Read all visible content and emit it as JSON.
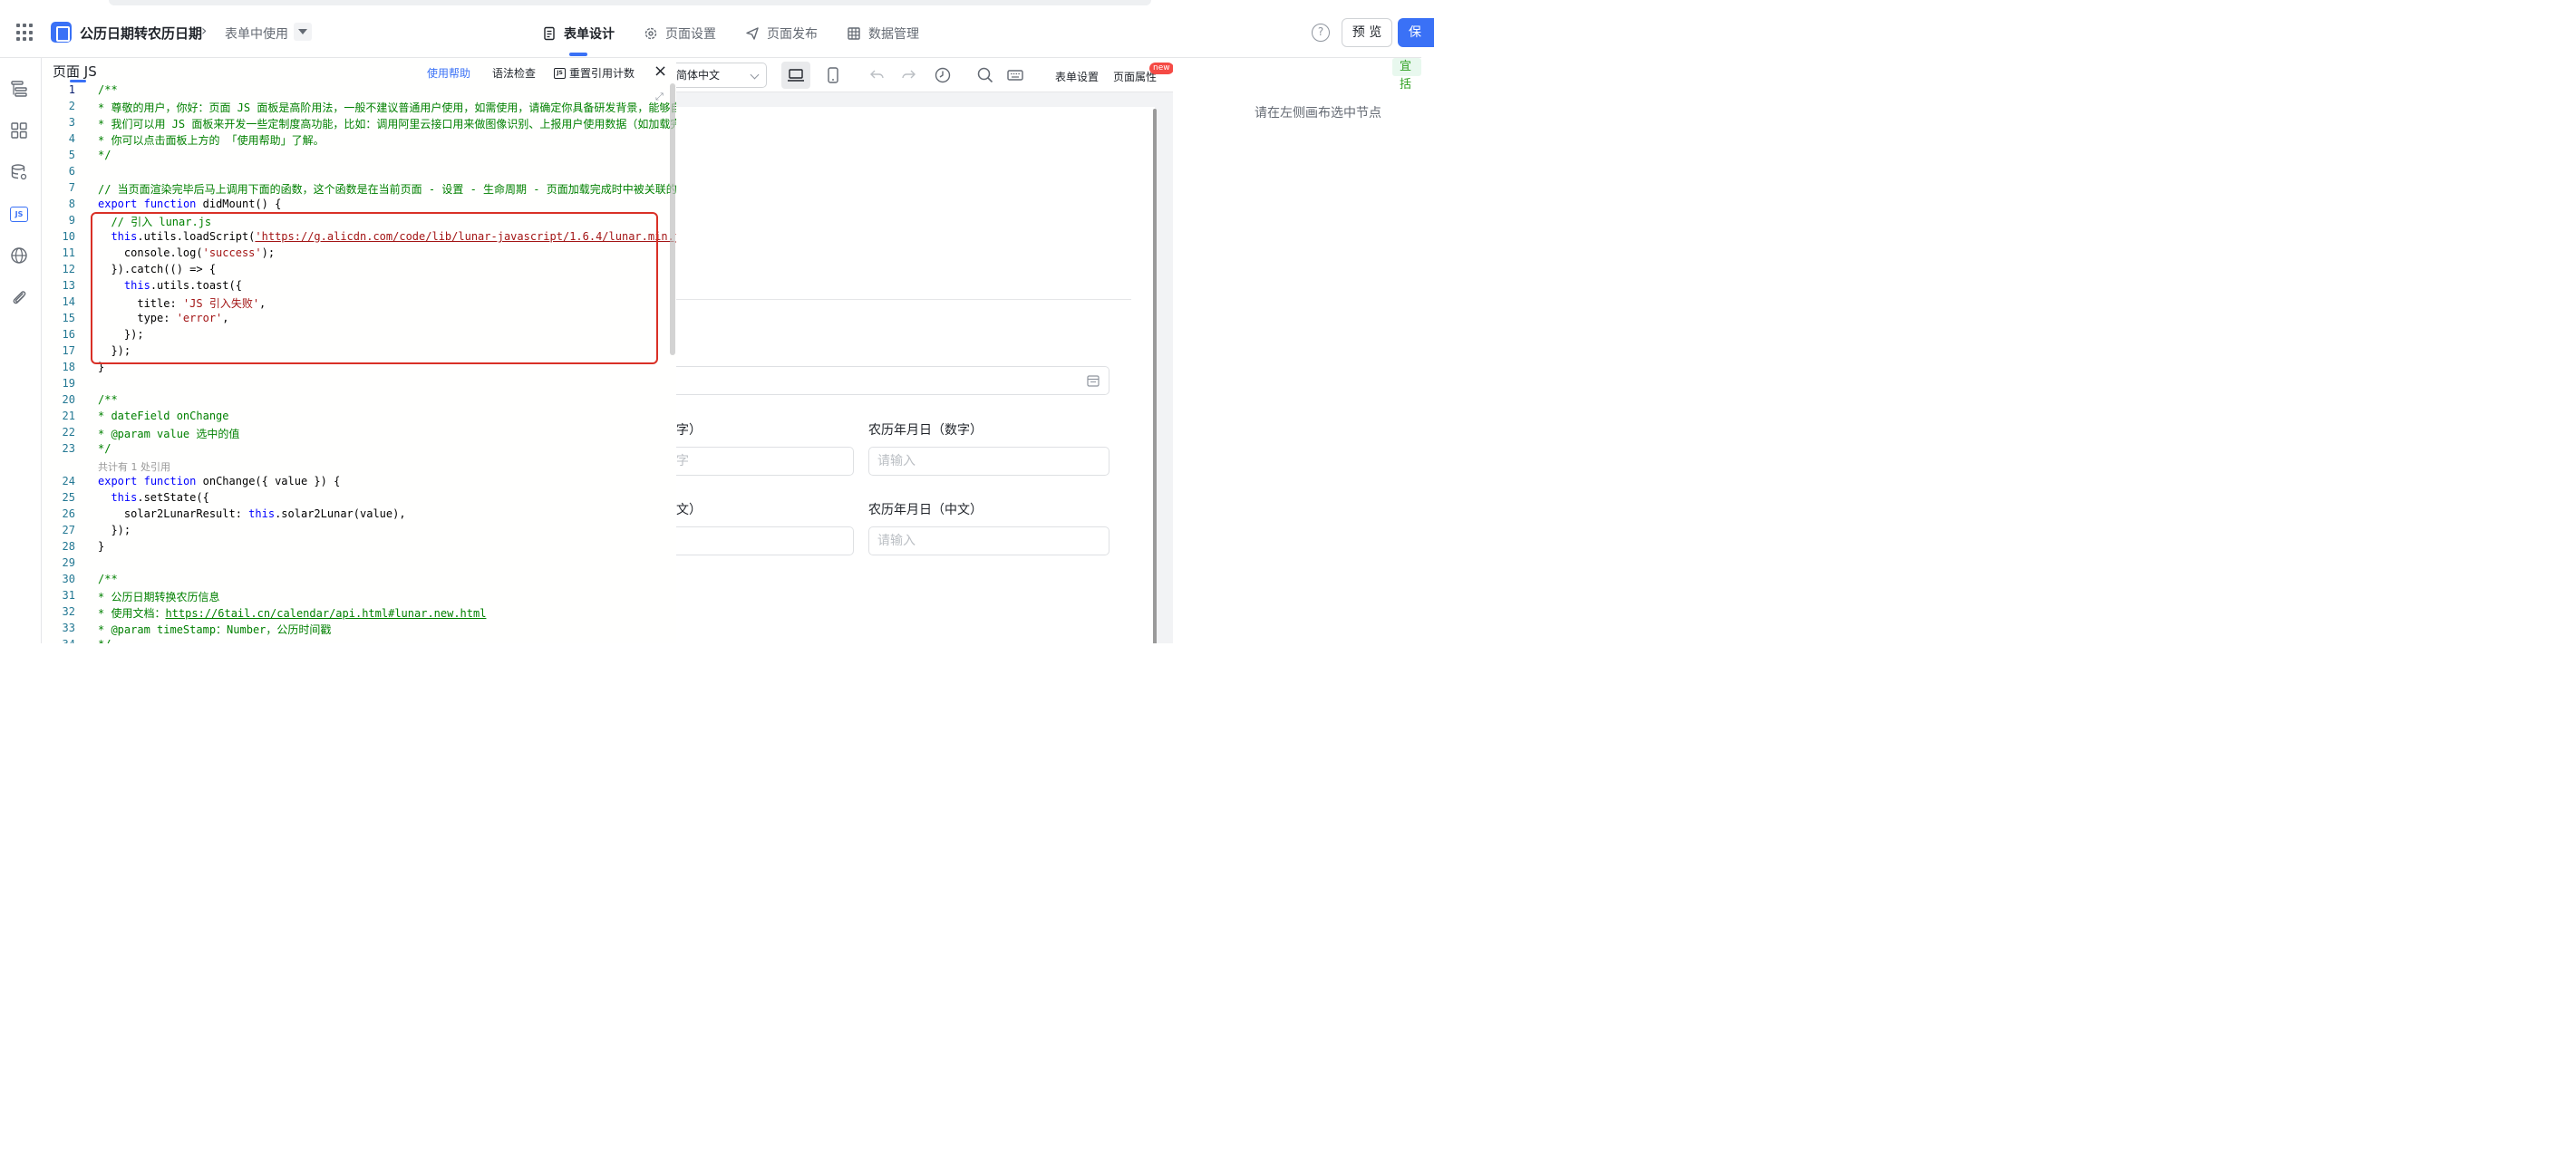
{
  "header": {
    "app_title": "公历日期转农历日期",
    "breadcrumb_sep": "›",
    "page_name": "表单中使用",
    "tabs": [
      {
        "label": "表单设计"
      },
      {
        "label": "页面设置"
      },
      {
        "label": "页面发布"
      },
      {
        "label": "数据管理"
      }
    ],
    "help": "?",
    "preview_label": "预 览",
    "save_label": "保"
  },
  "code_panel": {
    "title": "页面 JS",
    "help_link": "使用帮助",
    "lint_link": "语法检查",
    "reset_ref_link": "重置引用计数",
    "close": "×",
    "expand": "⤢",
    "line_numbers": [
      "1",
      "2",
      "3",
      "4",
      "5",
      "6",
      "7",
      "8",
      "9",
      "10",
      "11",
      "12",
      "13",
      "14",
      "15",
      "16",
      "17",
      "18",
      "19",
      "20",
      "21",
      "22",
      "23",
      "24",
      "25",
      "26",
      "27",
      "28",
      "29",
      "30",
      "31",
      "32",
      "33",
      "34"
    ],
    "ref_hint": "共计有 1 处引用",
    "lines": {
      "l1": "/**",
      "l2": "* 尊敬的用户，你好：页面 JS 面板是高阶用法，一般不建议普通用户使用，如需使用，请确定你具备研发背景，能够自",
      "l3": "* 我们可以用 JS 面板来开发一些定制度高功能，比如：调用阿里云接口用来做图像识别、上报用户使用数据（如加载完",
      "l4": "* 你可以点击面板上方的 「使用帮助」了解。",
      "l5": "*/",
      "l7": "// 当页面渲染完毕后马上调用下面的函数，这个函数是在当前页面 - 设置 - 生命周期 - 页面加载完成时中被关联的。",
      "l8_kw1": "export",
      "l8_kw2": "function",
      "l8_rest": " didMount() {",
      "l9": "  // 引入 lunar.js",
      "l10_kw": "this",
      "l10_a": ".utils.loadScript(",
      "l10_str": "'https://g.alicdn.com/code/lib/lunar-javascript/1.6.4/lunar.min.js'",
      "l11_a": "    console.log(",
      "l11_str": "'success'",
      "l11_b": ");",
      "l12": "  }).catch(() => {",
      "l13_kw": "this",
      "l13_a": ".utils.toast({",
      "l14_a": "      title: ",
      "l14_str": "'JS 引入失败'",
      "l14_b": ",",
      "l15_a": "      type: ",
      "l15_str": "'error'",
      "l15_b": ",",
      "l16": "    });",
      "l17": "  });",
      "l18": "}",
      "l20": "/**",
      "l21": "* dateField onChange",
      "l22": "* @param value 选中的值",
      "l23": "*/",
      "l24_kw1": "export",
      "l24_kw2": "function",
      "l24_rest": " onChange({ value }) {",
      "l25_kw": "this",
      "l25_a": ".setState({",
      "l26_a": "    solar2LunarResult: ",
      "l26_kw": "this",
      "l26_b": ".solar2Lunar(value),",
      "l27": "  });",
      "l28": "}",
      "l30": "/**",
      "l31": "* 公历日期转换农历信息",
      "l32_a": "* 使用文档：",
      "l32_url": "https://6tail.cn/calendar/api.html#lunar.new.html",
      "l33": "* @param timeStamp：Number，公历时间戳",
      "l34": "*/"
    }
  },
  "canvas": {
    "language": "简体中文",
    "form_settings": "表单设置",
    "page_props": "页面属性",
    "new_badge": "new",
    "label_partial_1": "字）",
    "label_lunar_num": "农历年月日（数字）",
    "input_partial_1": "字",
    "placeholder": "请输入",
    "label_partial_2": "文）",
    "label_lunar_cn": "农历年月日（中文）"
  },
  "right_panel": {
    "tip": "请在左侧画布选中节点",
    "tag": "宜括"
  },
  "colors": {
    "accent": "#3a71f6",
    "highlight_border": "#d93026",
    "code_comment": "#008000",
    "code_keyword": "#0000ff",
    "code_string": "#a31515"
  }
}
